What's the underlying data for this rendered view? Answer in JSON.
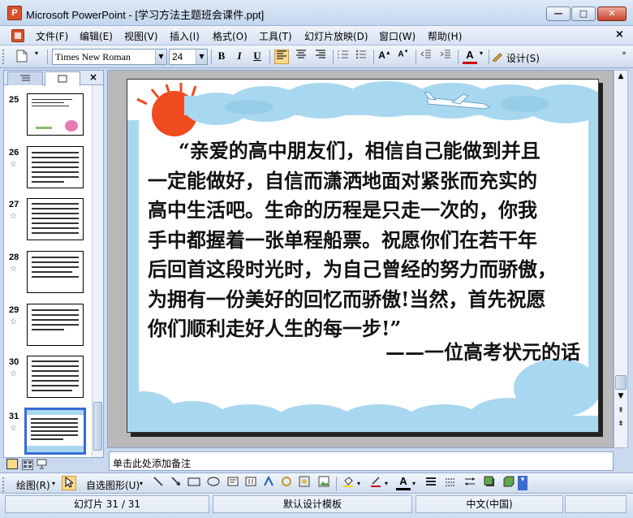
{
  "window": {
    "title": "Microsoft PowerPoint - [学习方法主题班会课件.ppt]",
    "app_icon_label": "P",
    "minimize_glyph": "—",
    "maximize_glyph": "□",
    "close_glyph": "✕",
    "doc_close_glyph": "×"
  },
  "menu": {
    "items": [
      "文件(F)",
      "编辑(E)",
      "视图(V)",
      "插入(I)",
      "格式(O)",
      "工具(T)",
      "幻灯片放映(D)",
      "窗口(W)",
      "帮助(H)"
    ]
  },
  "toolbar": {
    "font_name": "Times New Roman",
    "font_size": "24",
    "bold": "B",
    "italic": "I",
    "underline": "U",
    "design_label": "设计(S)"
  },
  "panel": {
    "close_glyph": "×",
    "thumbnails": [
      {
        "number": "25",
        "star": ""
      },
      {
        "number": "26",
        "star": "☆"
      },
      {
        "number": "27",
        "star": "☆"
      },
      {
        "number": "28",
        "star": "☆"
      },
      {
        "number": "29",
        "star": "☆"
      },
      {
        "number": "30",
        "star": "☆"
      },
      {
        "number": "31",
        "star": "☆"
      }
    ]
  },
  "slide": {
    "lines": [
      "“亲爱的高中朋友们，相信自己能做到并且",
      "一定能做好，自信而潇洒地面对紧张而充实的",
      "高中生活吧。生命的历程是只走一次的，你我",
      "手中都握着一张单程船票。祝愿你们在若干年",
      "后回首这段时光时，为自己曾经的努力而骄傲，",
      "为拥有一份美好的回忆而骄傲!当然，首先祝愿",
      "你们顺利走好人生的每一步!”"
    ],
    "signature": "——一位高考状元的话"
  },
  "notes": {
    "placeholder": "单击此处添加备注"
  },
  "drawbar": {
    "draw_label": "绘图(R)",
    "autoshapes_label": "自选图形(U)"
  },
  "status": {
    "slide_position": "幻灯片 31 / 31",
    "design_template": "默认设计模板",
    "language": "中文(中国)"
  },
  "colors": {
    "cloud": "#a8d8f0",
    "sun": "#f04a1f",
    "accent_font": "#cc0000"
  }
}
